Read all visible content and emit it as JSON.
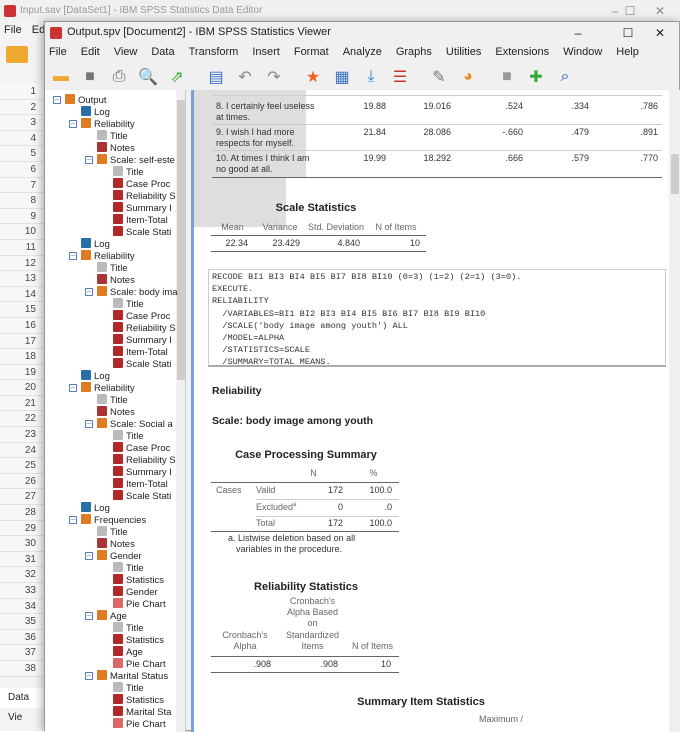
{
  "back_window": {
    "title": "Input.sav [DataSet1] - IBM SPSS Statistics Data Editor",
    "menu": [
      "File",
      "Ed"
    ],
    "row_numbers": [
      "1",
      "2",
      "3",
      "4",
      "5",
      "6",
      "7",
      "8",
      "9",
      "10",
      "11",
      "12",
      "13",
      "14",
      "15",
      "16",
      "17",
      "18",
      "19",
      "20",
      "21",
      "22",
      "23",
      "24",
      "25",
      "26",
      "27",
      "28",
      "29",
      "30",
      "31",
      "32",
      "33",
      "34",
      "35",
      "36",
      "37",
      "38"
    ],
    "tab": "Data Vie"
  },
  "window": {
    "title": "Output.spv [Document2] - IBM SPSS Statistics Viewer",
    "minimize": "–",
    "maximize": "☐",
    "close": "✕"
  },
  "menu": [
    "File",
    "Edit",
    "View",
    "Data",
    "Transform",
    "Insert",
    "Format",
    "Analyze",
    "Graphs",
    "Utilities",
    "Extensions",
    "Window",
    "Help"
  ],
  "toolbar": [
    "open-folder-icon",
    "save-icon",
    "print-icon",
    "print-preview-icon",
    "export-icon",
    "recall-dialog-icon",
    "undo-icon",
    "redo-icon",
    "goto-data-icon",
    "goto-case-icon",
    "goto-variable-icon",
    "variables-icon",
    "show-output-icon",
    "hide-output-icon",
    "designate-window-icon",
    "promote-icon",
    "search-icon"
  ],
  "tree": [
    {
      "t": "Output",
      "l": 0,
      "k": "book",
      "box": true
    },
    {
      "t": "Log",
      "l": 1,
      "k": "log"
    },
    {
      "t": "Reliability",
      "l": 1,
      "k": "book",
      "box": true
    },
    {
      "t": "Title",
      "l": 2,
      "k": "title"
    },
    {
      "t": "Notes",
      "l": 2,
      "k": "notes"
    },
    {
      "t": "Scale: self-este",
      "l": 2,
      "k": "book",
      "box": true
    },
    {
      "t": "Title",
      "l": 3,
      "k": "title"
    },
    {
      "t": "Case Proc",
      "l": 3,
      "k": "table"
    },
    {
      "t": "Reliability S",
      "l": 3,
      "k": "table"
    },
    {
      "t": "Summary I",
      "l": 3,
      "k": "table"
    },
    {
      "t": "Item-Total",
      "l": 3,
      "k": "table"
    },
    {
      "t": "Scale Stati",
      "l": 3,
      "k": "table"
    },
    {
      "t": "Log",
      "l": 1,
      "k": "log"
    },
    {
      "t": "Reliability",
      "l": 1,
      "k": "book",
      "box": true
    },
    {
      "t": "Title",
      "l": 2,
      "k": "title"
    },
    {
      "t": "Notes",
      "l": 2,
      "k": "notes"
    },
    {
      "t": "Scale: body ima",
      "l": 2,
      "k": "book",
      "box": true
    },
    {
      "t": "Title",
      "l": 3,
      "k": "title"
    },
    {
      "t": "Case Proc",
      "l": 3,
      "k": "table"
    },
    {
      "t": "Reliability S",
      "l": 3,
      "k": "table"
    },
    {
      "t": "Summary I",
      "l": 3,
      "k": "table"
    },
    {
      "t": "Item-Total",
      "l": 3,
      "k": "table"
    },
    {
      "t": "Scale Stati",
      "l": 3,
      "k": "table"
    },
    {
      "t": "Log",
      "l": 1,
      "k": "log"
    },
    {
      "t": "Reliability",
      "l": 1,
      "k": "book",
      "box": true
    },
    {
      "t": "Title",
      "l": 2,
      "k": "title"
    },
    {
      "t": "Notes",
      "l": 2,
      "k": "notes"
    },
    {
      "t": "Scale: Social a",
      "l": 2,
      "k": "book",
      "box": true
    },
    {
      "t": "Title",
      "l": 3,
      "k": "title"
    },
    {
      "t": "Case Proc",
      "l": 3,
      "k": "table"
    },
    {
      "t": "Reliability S",
      "l": 3,
      "k": "table"
    },
    {
      "t": "Summary I",
      "l": 3,
      "k": "table"
    },
    {
      "t": "Item-Total",
      "l": 3,
      "k": "table"
    },
    {
      "t": "Scale Stati",
      "l": 3,
      "k": "table"
    },
    {
      "t": "Log",
      "l": 1,
      "k": "log"
    },
    {
      "t": "Frequencies",
      "l": 1,
      "k": "book",
      "box": true
    },
    {
      "t": "Title",
      "l": 2,
      "k": "title"
    },
    {
      "t": "Notes",
      "l": 2,
      "k": "notes"
    },
    {
      "t": "Gender",
      "l": 2,
      "k": "book",
      "box": true
    },
    {
      "t": "Title",
      "l": 3,
      "k": "title"
    },
    {
      "t": "Statistics",
      "l": 3,
      "k": "table"
    },
    {
      "t": "Gender",
      "l": 3,
      "k": "table"
    },
    {
      "t": "Pie Chart",
      "l": 3,
      "k": "chart"
    },
    {
      "t": "Age",
      "l": 2,
      "k": "book",
      "box": true
    },
    {
      "t": "Title",
      "l": 3,
      "k": "title"
    },
    {
      "t": "Statistics",
      "l": 3,
      "k": "table"
    },
    {
      "t": "Age",
      "l": 3,
      "k": "table"
    },
    {
      "t": "Pie Chart",
      "l": 3,
      "k": "chart"
    },
    {
      "t": "Marital Status",
      "l": 2,
      "k": "book",
      "box": true
    },
    {
      "t": "Title",
      "l": 3,
      "k": "title"
    },
    {
      "t": "Statistics",
      "l": 3,
      "k": "table"
    },
    {
      "t": "Marital Sta",
      "l": 3,
      "k": "table"
    },
    {
      "t": "Pie Chart",
      "l": 3,
      "k": "chart"
    }
  ],
  "item_total": {
    "rows": [
      {
        "label": [
          "8. I certainly feel useless",
          "at times."
        ],
        "v": [
          "19.88",
          "19.016",
          ".524",
          ".334",
          ".786"
        ]
      },
      {
        "label": [
          "9. I wish I had more",
          "respects for myself."
        ],
        "v": [
          "21.84",
          "28.086",
          "-.660",
          ".479",
          ".891"
        ]
      },
      {
        "label": [
          "10. At times I think I am",
          "no good at all."
        ],
        "v": [
          "19.99",
          "18.292",
          ".666",
          ".579",
          ".770"
        ]
      }
    ]
  },
  "scale_stats": {
    "title": "Scale Statistics",
    "headers": [
      "Mean",
      "Variance",
      "Std. Deviation",
      "N of Items"
    ],
    "values": [
      "22.34",
      "23.429",
      "4.840",
      "10"
    ]
  },
  "syntax": [
    "RECODE BI1 BI3 BI4 BI5 BI7 BI8 BI10 (0=3) (1=2) (2=1) (3=0).",
    "EXECUTE.",
    "RELIABILITY",
    "  /VARIABLES=BI1 BI2 BI3 BI4 BI5 BI6 BI7 BI8 BI9 BI10",
    "  /SCALE('body image among youth') ALL",
    "  /MODEL=ALPHA",
    "  /STATISTICS=SCALE",
    "  /SUMMARY=TOTAL MEANS."
  ],
  "heading": "Reliability",
  "scale_heading": "Scale: body image among youth",
  "case_summary": {
    "title": "Case Processing Summary",
    "col_n": "N",
    "col_pct": "%",
    "group": "Cases",
    "rows": [
      {
        "label": "Valid",
        "n": "172",
        "pct": "100.0"
      },
      {
        "label": "Excluded",
        "sup": "a",
        "n": "0",
        "pct": ".0"
      },
      {
        "label": "Total",
        "n": "172",
        "pct": "100.0"
      }
    ],
    "footnote": [
      "a. Listwise deletion based on all",
      "variables in the procedure."
    ]
  },
  "reliability_stats": {
    "title": "Reliability Statistics",
    "headers": [
      [
        "Cronbach's",
        "Alpha"
      ],
      [
        "Cronbach's",
        "Alpha Based",
        "on",
        "Standardized",
        "Items"
      ],
      [
        "N of Items"
      ]
    ],
    "values": [
      ".908",
      ".908",
      "10"
    ]
  },
  "summary_item": {
    "title": "Summary Item Statistics",
    "header_partial": "Maximum /"
  }
}
